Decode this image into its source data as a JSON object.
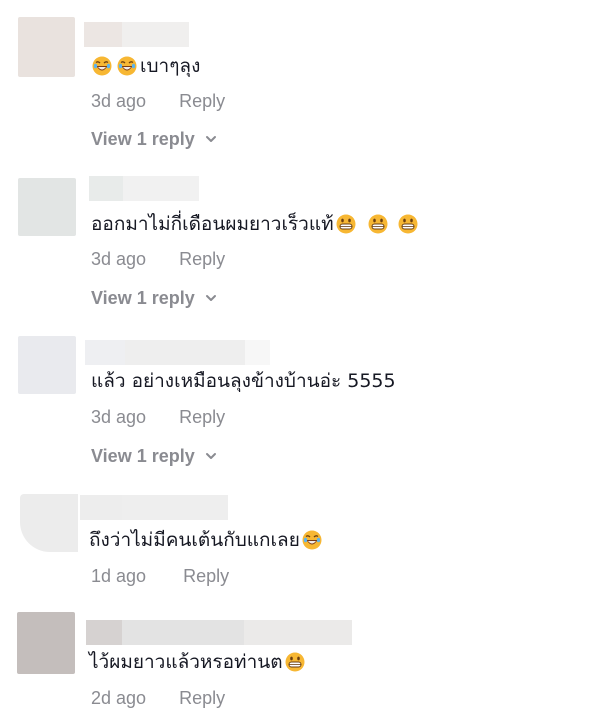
{
  "comments": [
    {
      "text": "เบาๆลุง",
      "emojis": [
        "laughing-face-icon",
        "laughing-face-icon"
      ],
      "emoji_position": "before",
      "time": "3d ago",
      "reply_label": "Reply",
      "view_replies_label": "View 1 reply"
    },
    {
      "text": "ออกมาไม่กี่เดือนผมยาวเร็วแท้",
      "emojis": [
        "grinning-face-icon",
        "grinning-face-icon",
        "grinning-face-icon"
      ],
      "emoji_position": "after",
      "time": "3d ago",
      "reply_label": "Reply",
      "view_replies_label": "View 1 reply"
    },
    {
      "text": "แล้ว อย่างเหมือนลุงข้างบ้านอ่ะ 5555",
      "emojis": [],
      "time": "3d ago",
      "reply_label": "Reply",
      "view_replies_label": "View 1 reply"
    },
    {
      "text": "ถึงว่าไม่มีคนเต้นกับแกเลย",
      "emojis": [
        "laughing-face-icon"
      ],
      "emoji_position": "after",
      "time": "1d ago",
      "reply_label": "Reply"
    },
    {
      "text": "ไว้ผมยาวแล้วหรอท่านต",
      "emojis": [
        "grinning-face-icon"
      ],
      "emoji_position": "after",
      "time": "2d ago",
      "reply_label": "Reply"
    }
  ],
  "colors": {
    "text": "#161823",
    "meta": "#8a8b91",
    "emoji_face": "#f7b733",
    "blur_light": "#eeeeee",
    "blur_dark": "#d8d4d2"
  }
}
